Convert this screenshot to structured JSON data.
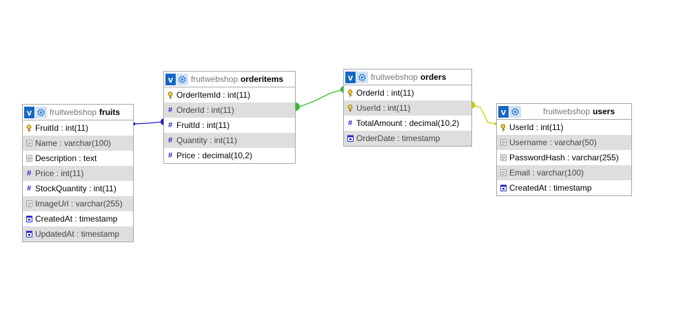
{
  "database": "fruitwebshop",
  "colors": {
    "fk_fruits_orderitems": "#1a1acc",
    "fk_orders_orderitems": "#33bb33",
    "fk_users_orders": "#cccc00",
    "header_button": "#1567c4",
    "row_alt": "#dedede"
  },
  "tables": [
    {
      "name": "fruits",
      "header_text": "fruitwebshop",
      "columns": [
        {
          "label": "FruitId : int(11)",
          "icon": "primary-key-icon"
        },
        {
          "label": "Name : varchar(100)",
          "icon": "text-column-icon"
        },
        {
          "label": "Description : text",
          "icon": "text-column-icon"
        },
        {
          "label": "Price : int(11)",
          "icon": "numeric-column-icon"
        },
        {
          "label": "StockQuantity : int(11)",
          "icon": "numeric-column-icon"
        },
        {
          "label": "ImageUrl : varchar(255)",
          "icon": "text-column-icon"
        },
        {
          "label": "CreatedAt : timestamp",
          "icon": "date-column-icon"
        },
        {
          "label": "UpdatedAt : timestamp",
          "icon": "date-column-icon"
        }
      ]
    },
    {
      "name": "orderitems",
      "header_text": "fruitwebshop",
      "columns": [
        {
          "label": "OrderItemId : int(11)",
          "icon": "primary-key-icon"
        },
        {
          "label": "OrderId : int(11)",
          "icon": "numeric-column-icon"
        },
        {
          "label": "FruitId : int(11)",
          "icon": "numeric-column-icon"
        },
        {
          "label": "Quantity : int(11)",
          "icon": "numeric-column-icon"
        },
        {
          "label": "Price : decimal(10,2)",
          "icon": "numeric-column-icon"
        }
      ]
    },
    {
      "name": "orders",
      "header_text": "fruitwebshop",
      "columns": [
        {
          "label": "OrderId : int(11)",
          "icon": "primary-key-icon"
        },
        {
          "label": "UserId : int(11)",
          "icon": "primary-key-icon"
        },
        {
          "label": "TotalAmount : decimal(10,2)",
          "icon": "numeric-column-icon"
        },
        {
          "label": "OrderDate : timestamp",
          "icon": "date-column-icon"
        }
      ]
    },
    {
      "name": "users",
      "header_text": "fruitwebshop",
      "columns": [
        {
          "label": "UserId : int(11)",
          "icon": "primary-key-icon"
        },
        {
          "label": "Username : varchar(50)",
          "icon": "text-column-icon"
        },
        {
          "label": "PasswordHash : varchar(255)",
          "icon": "text-column-icon"
        },
        {
          "label": "Email : varchar(100)",
          "icon": "text-column-icon"
        },
        {
          "label": "CreatedAt : timestamp",
          "icon": "date-column-icon"
        }
      ]
    }
  ]
}
